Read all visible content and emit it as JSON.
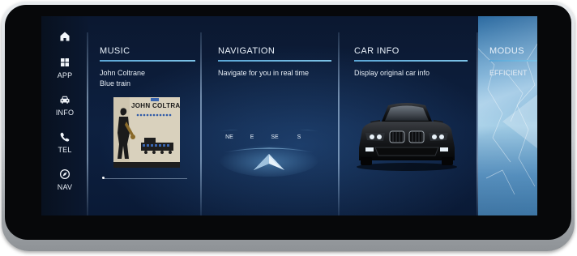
{
  "sidebar": {
    "items": [
      {
        "label": "",
        "icon": "home-icon"
      },
      {
        "label": "APP",
        "icon": "apps-grid-icon"
      },
      {
        "label": "INFO",
        "icon": "car-icon"
      },
      {
        "label": "TEL",
        "icon": "phone-icon"
      },
      {
        "label": "NAV",
        "icon": "compass-icon"
      }
    ]
  },
  "music": {
    "title": "MUSIC",
    "artist": "John Coltrane",
    "track": "Blue train",
    "album_cover_text": "JOHN COLTRANE"
  },
  "navigation": {
    "title": "NAVIGATION",
    "subtitle": "Navigate for you in real time",
    "compass_ticks": [
      "NE",
      "E",
      "SE",
      "S"
    ]
  },
  "car_info": {
    "title": "CAR INFO",
    "subtitle": "Display original car info"
  },
  "modus": {
    "title": "MODUS",
    "mode": "EFFICIENT"
  },
  "colors": {
    "accent": "#5aa6d6",
    "background": "#0b1830",
    "text": "#eaf2fb"
  }
}
